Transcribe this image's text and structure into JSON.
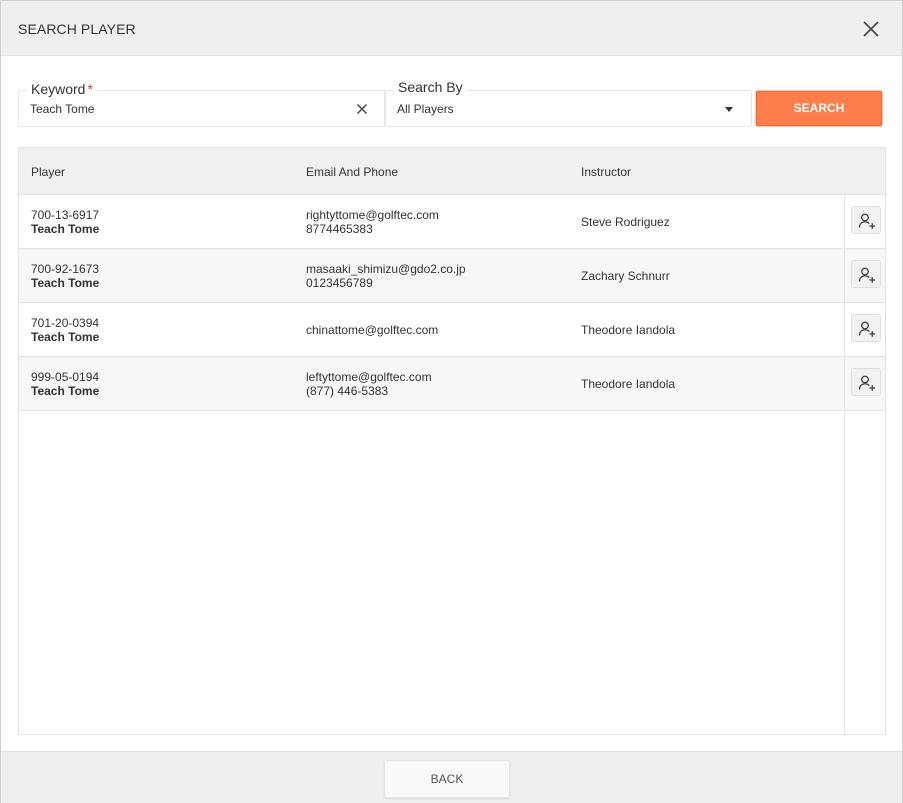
{
  "dialog": {
    "title": "SEARCH PLAYER"
  },
  "keyword": {
    "label": "Keyword",
    "required_mark": "*",
    "value": "Teach Tome"
  },
  "search_by": {
    "label": "Search By",
    "value": "All Players"
  },
  "search_button": {
    "label": "SEARCH"
  },
  "table": {
    "headers": [
      "Player",
      "Email And Phone",
      "Instructor"
    ],
    "rows": [
      {
        "player_id": "700-13-6917",
        "player_name": "Teach Tome",
        "email": "rightyttome@golftec.com",
        "phone": "8774465383",
        "instructor": "Steve Rodriguez"
      },
      {
        "player_id": "700-92-1673",
        "player_name": "Teach Tome",
        "email": "masaaki_shimizu@gdo2.co.jp",
        "phone": "0123456789",
        "instructor": "Zachary Schnurr"
      },
      {
        "player_id": "701-20-0394",
        "player_name": "Teach Tome",
        "email": "chinattome@golftec.com",
        "phone": "",
        "instructor": "Theodore Iandola"
      },
      {
        "player_id": "999-05-0194",
        "player_name": "Teach Tome",
        "email": "leftyttome@golftec.com",
        "phone": "(877) 446-5383",
        "instructor": "Theodore Iandola"
      }
    ]
  },
  "back_button": {
    "label": "BACK"
  },
  "colors": {
    "accent": "#fd7e4a",
    "required": "#e53935",
    "header_bg": "#efefef"
  },
  "icons": {
    "close": "close-icon",
    "dropdown": "caret-down-icon",
    "clear": "clear-icon",
    "add_player": "add-user-icon"
  }
}
